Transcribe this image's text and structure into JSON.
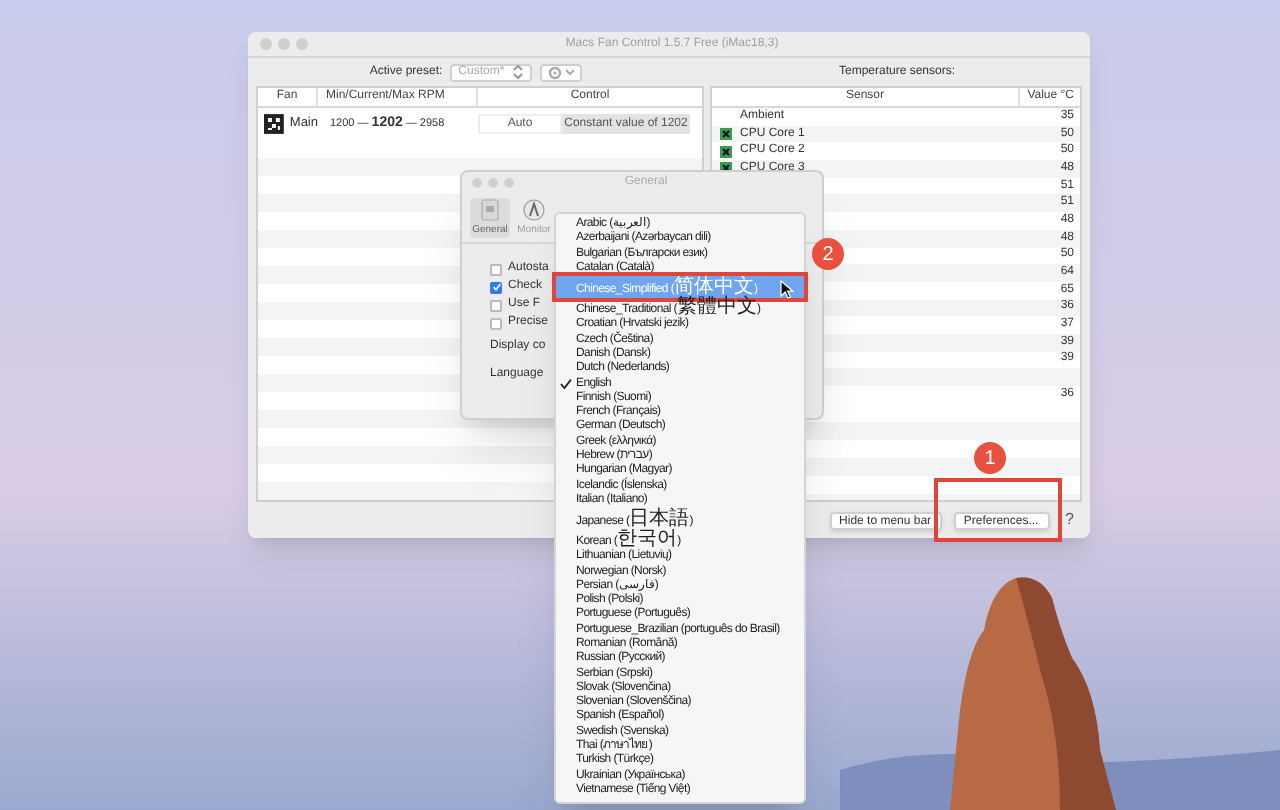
{
  "window": {
    "title": "Macs Fan Control 1.5.7 Free (iMac18,3)"
  },
  "preset": {
    "label": "Active preset:",
    "value": "Custom*"
  },
  "fans": {
    "columns": [
      "Fan",
      "Min/Current/Max RPM",
      "Control"
    ],
    "rows": [
      {
        "name": "Main",
        "rpm": "1200 — **1202** — 2958",
        "modes": [
          {
            "label": "Auto",
            "selected": false
          },
          {
            "label": "Constant value of 1202",
            "selected": true
          }
        ]
      }
    ]
  },
  "sensors": {
    "title": "Temperature sensors:",
    "columns": [
      "Sensor",
      "Value °C"
    ],
    "rows": [
      {
        "kind": "ambient",
        "name": "Ambient",
        "value": "35"
      },
      {
        "kind": "core",
        "name": "CPU Core 1",
        "value": "50"
      },
      {
        "kind": "core",
        "name": "CPU Core 2",
        "value": "50"
      },
      {
        "kind": "core",
        "name": "CPU Core 3",
        "value": "48"
      },
      {
        "value": "51"
      },
      {
        "value": "51"
      },
      {
        "value": "48"
      },
      {
        "value": "48"
      },
      {
        "value": "50"
      },
      {
        "value": "64"
      },
      {
        "value": "65"
      },
      {
        "value": "36"
      },
      {
        "value": "37"
      },
      {
        "value": "39"
      },
      {
        "value": "39"
      },
      {},
      {
        "value": "36"
      }
    ]
  },
  "buttons": [
    {
      "label": "Hide to menu bar"
    },
    {
      "label": "Preferences..."
    }
  ],
  "help": "?",
  "preferences": {
    "title": "General",
    "tabs": [
      {
        "label": "General",
        "selected": true
      },
      {
        "label": "Monitor",
        "selected": false
      }
    ],
    "options": [
      {
        "kind": "checkbox",
        "label": "Autosta",
        "checked": false
      },
      {
        "kind": "checkbox",
        "label": "Check",
        "checked": true
      },
      {
        "kind": "checkbox",
        "label": "Use F",
        "checked": false
      },
      {
        "kind": "checkbox",
        "label": "Precise",
        "checked": false
      },
      {
        "kind": "text",
        "label": "Display co"
      },
      {
        "kind": "text",
        "label": "Language"
      }
    ]
  },
  "language_menu": {
    "items": [
      {
        "label": "Arabic (العربية)",
        "checked": false,
        "selected": false
      },
      {
        "label": "Azerbaijani (Azərbaycan dili)",
        "checked": false,
        "selected": false
      },
      {
        "label": "Bulgarian (Български език)",
        "checked": false,
        "selected": false
      },
      {
        "label": "Catalan (Català)",
        "checked": false,
        "selected": false
      },
      {
        "label": "Chinese_Simplified (简体中文)",
        "checked": false,
        "selected": true
      },
      {
        "label": "Chinese_Traditional (繁體中文)",
        "checked": false,
        "selected": false
      },
      {
        "label": "Croatian (Hrvatski jezik)",
        "checked": false,
        "selected": false
      },
      {
        "label": "Czech (Čeština)",
        "checked": false,
        "selected": false
      },
      {
        "label": "Danish (Dansk)",
        "checked": false,
        "selected": false
      },
      {
        "label": "Dutch (Nederlands)",
        "checked": false,
        "selected": false
      },
      {
        "label": "English",
        "checked": true,
        "selected": false
      },
      {
        "label": "Finnish (Suomi)",
        "checked": false,
        "selected": false
      },
      {
        "label": "French (Français)",
        "checked": false,
        "selected": false
      },
      {
        "label": "German (Deutsch)",
        "checked": false,
        "selected": false
      },
      {
        "label": "Greek (ελληνικά)",
        "checked": false,
        "selected": false
      },
      {
        "label": "Hebrew (עברית)",
        "checked": false,
        "selected": false
      },
      {
        "label": "Hungarian (Magyar)",
        "checked": false,
        "selected": false
      },
      {
        "label": "Icelandic (Íslenska)",
        "checked": false,
        "selected": false
      },
      {
        "label": "Italian (Italiano)",
        "checked": false,
        "selected": false
      },
      {
        "label": "Japanese (日本語)",
        "checked": false,
        "selected": false
      },
      {
        "label": "Korean (한국어)",
        "checked": false,
        "selected": false
      },
      {
        "label": "Lithuanian (Lietuvių)",
        "checked": false,
        "selected": false
      },
      {
        "label": "Norwegian (Norsk)",
        "checked": false,
        "selected": false
      },
      {
        "label": "Persian (فارسی)",
        "checked": false,
        "selected": false
      },
      {
        "label": "Polish (Polski)",
        "checked": false,
        "selected": false
      },
      {
        "label": "Portuguese (Português)",
        "checked": false,
        "selected": false
      },
      {
        "label": "Portuguese_Brazilian (português do Brasil)",
        "checked": false,
        "selected": false
      },
      {
        "label": "Romanian (Română)",
        "checked": false,
        "selected": false
      },
      {
        "label": "Russian (Русский)",
        "checked": false,
        "selected": false
      },
      {
        "label": "Serbian (Srpski)",
        "checked": false,
        "selected": false
      },
      {
        "label": "Slovak (Slovenčina)",
        "checked": false,
        "selected": false
      },
      {
        "label": "Slovenian (Slovenščina)",
        "checked": false,
        "selected": false
      },
      {
        "label": "Spanish (Español)",
        "checked": false,
        "selected": false
      },
      {
        "label": "Swedish (Svenska)",
        "checked": false,
        "selected": false
      },
      {
        "label": "Thai (ภาษาไทย)",
        "checked": false,
        "selected": false
      },
      {
        "label": "Turkish (Türkçe)",
        "checked": false,
        "selected": false
      },
      {
        "label": "Ukrainian (Українська)",
        "checked": false,
        "selected": false
      },
      {
        "label": "Vietnamese (Tiếng Việt)",
        "checked": false,
        "selected": false
      }
    ]
  },
  "annotations": [
    {
      "label": "1"
    },
    {
      "label": "2"
    }
  ]
}
